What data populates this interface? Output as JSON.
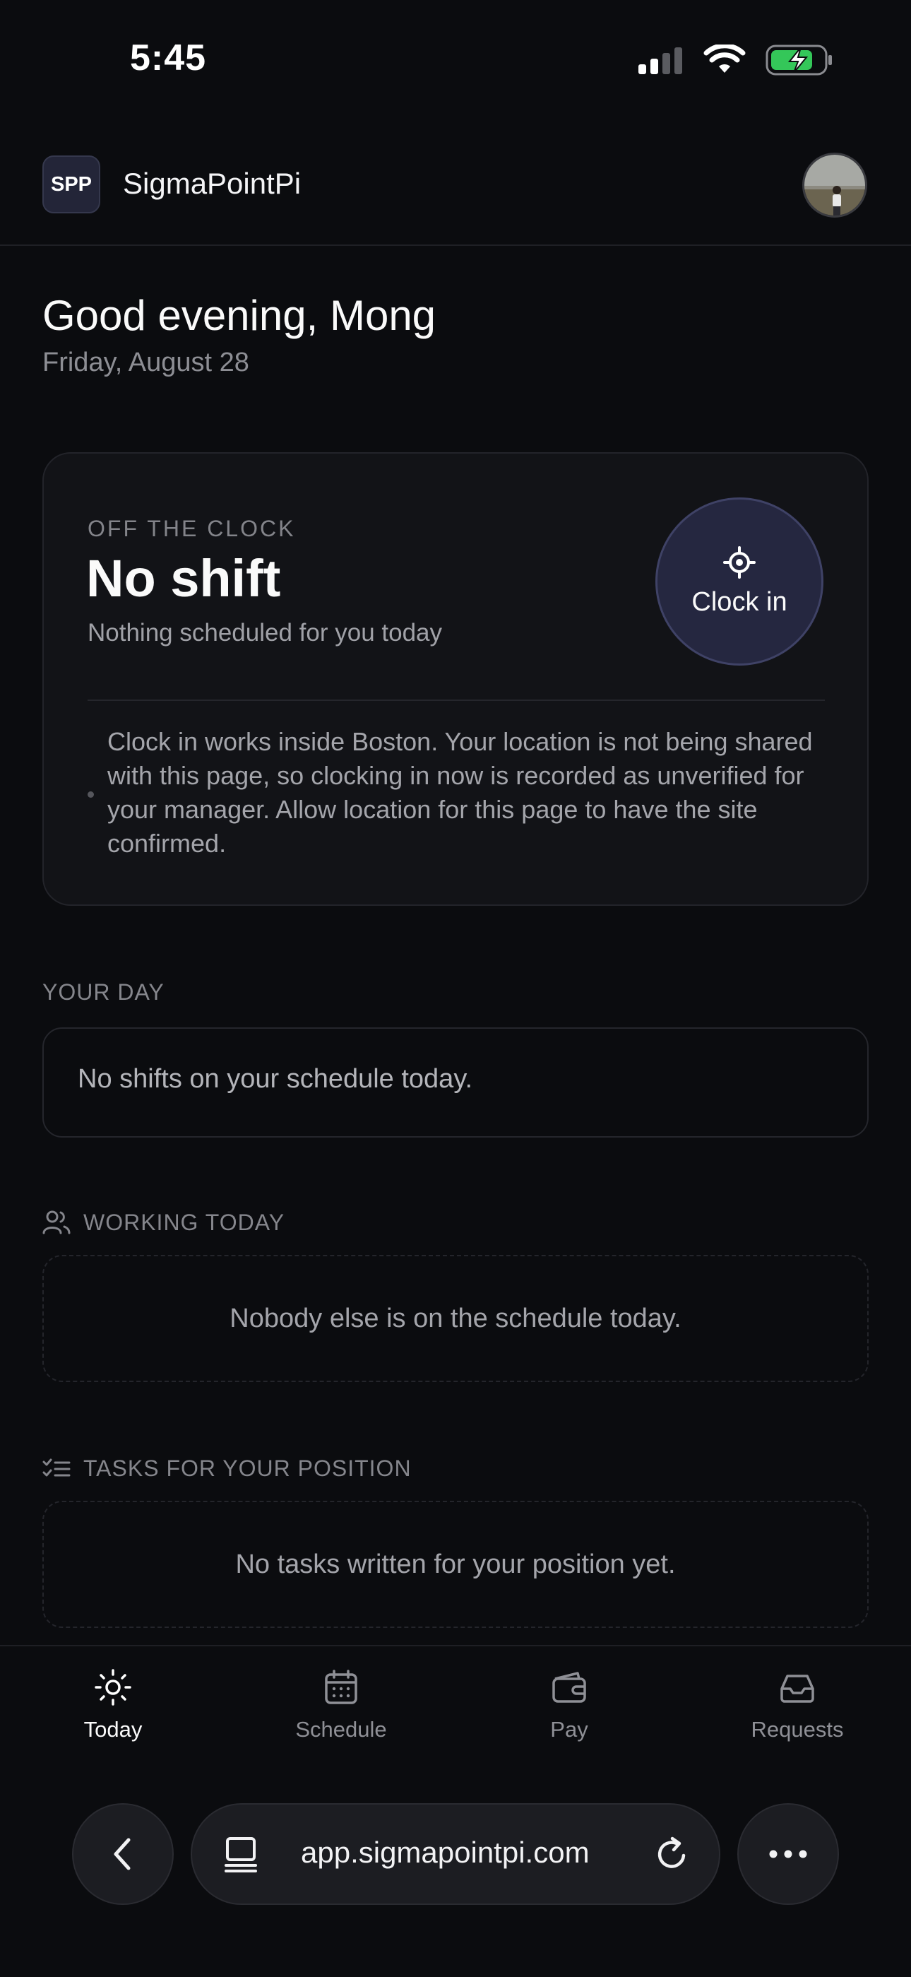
{
  "status_bar": {
    "time": "5:45"
  },
  "header": {
    "logo_text": "SPP",
    "app_name": "SigmaPointPi"
  },
  "greeting": {
    "title": "Good evening, Mong",
    "date": "Friday, August 28"
  },
  "clock_card": {
    "status_label": "OFF THE CLOCK",
    "shift_title": "No shift",
    "shift_subtitle": "Nothing scheduled for you today",
    "clock_in_label": "Clock in",
    "notice": "Clock in works inside Boston. Your location is not being shared with this page, so clocking in now is recorded as unverified for your manager. Allow location for this page to have the site confirmed."
  },
  "your_day": {
    "label": "YOUR DAY",
    "empty_text": "No shifts on your schedule today."
  },
  "working_today": {
    "label": "WORKING TODAY",
    "empty_text": "Nobody else is on the schedule today."
  },
  "tasks": {
    "label": "TASKS FOR YOUR POSITION",
    "empty_text": "No tasks written for your position yet."
  },
  "tabs": [
    {
      "label": "Today",
      "icon": "sun-icon",
      "active": true
    },
    {
      "label": "Schedule",
      "icon": "calendar-icon",
      "active": false
    },
    {
      "label": "Pay",
      "icon": "wallet-icon",
      "active": false
    },
    {
      "label": "Requests",
      "icon": "inbox-icon",
      "active": false
    }
  ],
  "browser": {
    "url": "app.sigmapointpi.com"
  },
  "colors": {
    "background": "#0b0c0f",
    "card": "#121317",
    "accent": "#252740",
    "battery": "#34c759"
  }
}
